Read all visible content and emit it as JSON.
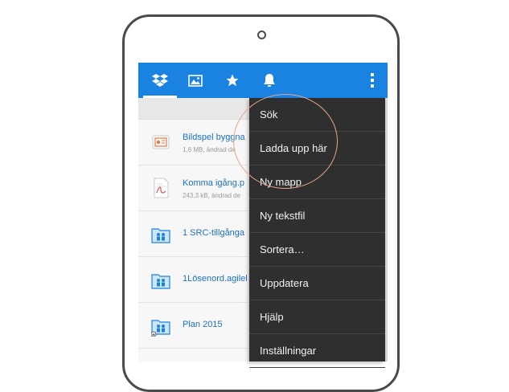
{
  "topbar": {
    "tabs": [
      {
        "icon": "dropbox-icon",
        "active": true
      },
      {
        "icon": "photos-icon",
        "active": false
      },
      {
        "icon": "star-icon",
        "active": false
      },
      {
        "icon": "bell-icon",
        "active": false
      }
    ],
    "overflow_icon": "more-vertical-icon",
    "color": "#1a82e0"
  },
  "files": [
    {
      "name": "Bildspel byggna",
      "meta": "1,6 MB, ändrad de",
      "type": "presentation"
    },
    {
      "name": "Komma igång.p",
      "meta": "243,3 kB, ändrad de",
      "type": "pdf"
    },
    {
      "name": "1 SRC-tillgånga",
      "meta": "",
      "type": "shared-folder"
    },
    {
      "name": "1Lösenord.agilel",
      "meta": "",
      "type": "shared-folder"
    },
    {
      "name": "Plan 2015",
      "meta": "",
      "type": "shared-folder-locked"
    },
    {
      "name": "",
      "meta": "",
      "type": "shared-folder"
    }
  ],
  "menu": {
    "items": [
      {
        "label": "Sök"
      },
      {
        "label": "Ladda upp här"
      },
      {
        "label": "Ny mapp"
      },
      {
        "label": "Ny tekstfil"
      },
      {
        "label": "Sortera…"
      },
      {
        "label": "Uppdatera"
      },
      {
        "label": "Hjälp"
      },
      {
        "label": "Inställningar"
      }
    ]
  },
  "highlight_color": "#e8a58a"
}
